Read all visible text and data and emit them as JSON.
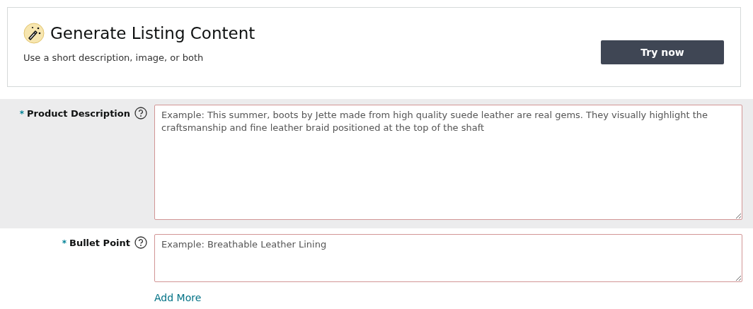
{
  "banner": {
    "title": "Generate Listing Content",
    "subtitle": "Use a short description, image, or both",
    "button": "Try now"
  },
  "fields": [
    {
      "label": "Product Description",
      "required": true,
      "required_mark": "*",
      "invalid": true,
      "highlighted": true,
      "kind": "large",
      "placeholder": "Example: This summer, boots by Jette made from high quality suede leather are real gems. They visually highlight the craftsmanship and fine leather braid positioned at the top of the shaft"
    },
    {
      "label": "Bullet Point",
      "required": true,
      "required_mark": "*",
      "invalid": true,
      "highlighted": false,
      "kind": "small",
      "placeholder": "Example: Breathable Leather Lining",
      "link": "Add More"
    }
  ]
}
